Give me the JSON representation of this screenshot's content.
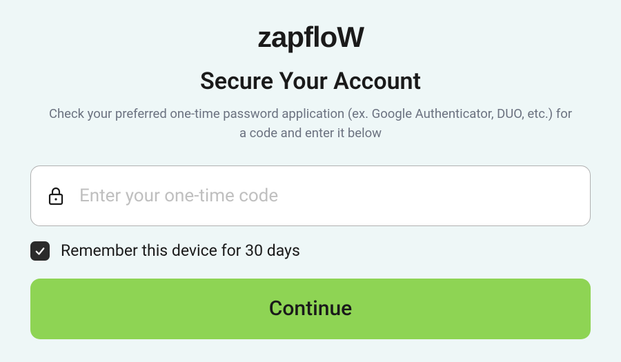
{
  "brand": {
    "name": "zapfloW"
  },
  "heading": "Secure Your Account",
  "subheading": "Check your preferred one-time password application (ex. Google Authenticator, DUO, etc.) for a code and enter it below",
  "code_input": {
    "placeholder": "Enter your one-time code",
    "value": ""
  },
  "remember": {
    "label": "Remember this device for 30 days",
    "checked": true
  },
  "continue_label": "Continue",
  "colors": {
    "background": "#eef7f7",
    "primary_button": "#8ed454",
    "text": "#1a1a1a",
    "subtext": "#6b7280",
    "placeholder": "#bfbfbf",
    "input_border": "#b0b0b0",
    "checkbox_bg": "#2b2b2b"
  }
}
